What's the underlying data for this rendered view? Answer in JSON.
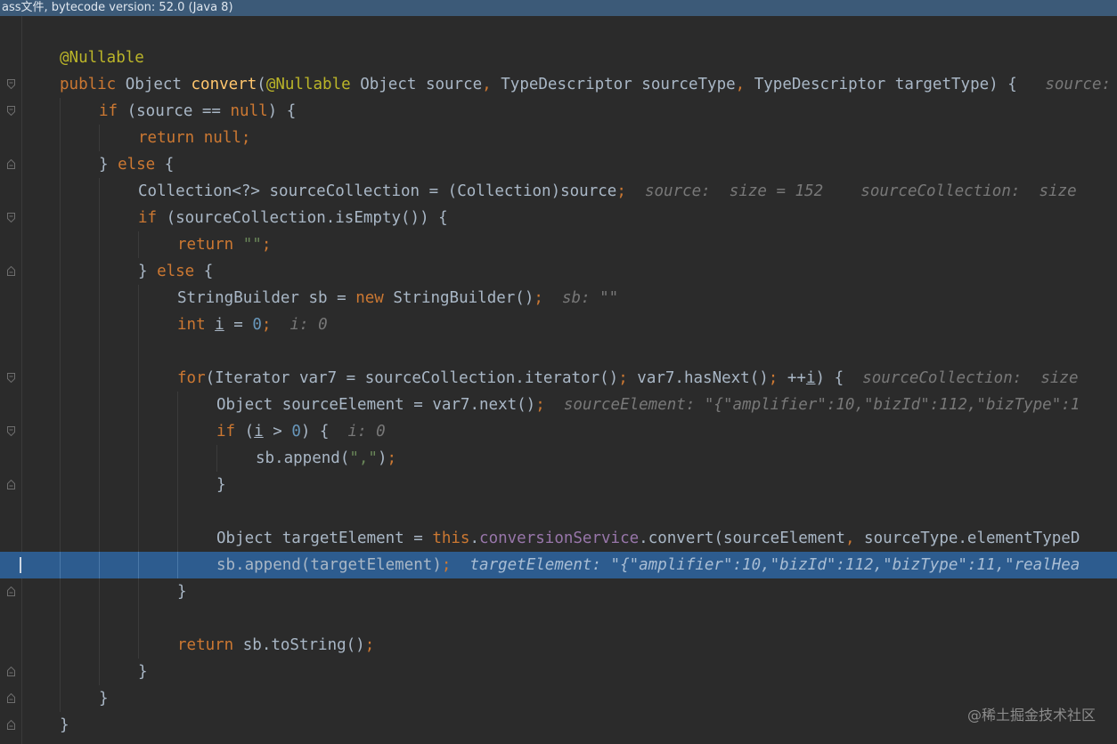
{
  "window": {
    "title_fragment": "ass文件, bytecode version: 52.0 (Java 8)"
  },
  "colors": {
    "background": "#2b2b2b",
    "keyword": "#cc7832",
    "annotation": "#bbb529",
    "method": "#ffc66d",
    "string": "#6a8759",
    "number": "#6897bb",
    "field": "#9876aa",
    "default_text": "#a9b7c6",
    "inline_hint": "#787878",
    "execution_line": "#2d5c8f"
  },
  "editor": {
    "current_line": "sb.append(targetElement);",
    "lines": [
      {
        "tokens": [
          {
            "t": "@Nullable"
          }
        ]
      },
      {
        "tokens": [
          {
            "t": "public"
          },
          {
            "t": " Object "
          },
          {
            "t": "convert"
          },
          {
            "t": "("
          },
          {
            "t": "@Nullable"
          },
          {
            "t": " Object source"
          },
          {
            "t": ","
          },
          {
            "t": " TypeDescriptor sourceType"
          },
          {
            "t": ","
          },
          {
            "t": " TypeDescriptor targetType) {"
          },
          {
            "t": "   source:"
          }
        ]
      },
      {
        "tokens": [
          {
            "t": "if"
          },
          {
            "t": " (source == "
          },
          {
            "t": "null"
          },
          {
            "t": ") {"
          }
        ]
      },
      {
        "tokens": [
          {
            "t": "return null"
          },
          {
            "t": ";"
          }
        ]
      },
      {
        "tokens": [
          {
            "t": "} "
          },
          {
            "t": "else"
          },
          {
            "t": " {"
          }
        ]
      },
      {
        "tokens": [
          {
            "t": "Collection<?> sourceCollection = (Collection)source"
          },
          {
            "t": ";"
          },
          {
            "t": "  source:  size = 152    sourceCollection:  size"
          }
        ]
      },
      {
        "tokens": [
          {
            "t": "if"
          },
          {
            "t": " (sourceCollection.isEmpty()) {"
          }
        ]
      },
      {
        "tokens": [
          {
            "t": "return "
          },
          {
            "t": "\"\""
          },
          {
            "t": ";"
          }
        ]
      },
      {
        "tokens": [
          {
            "t": "} "
          },
          {
            "t": "else"
          },
          {
            "t": " {"
          }
        ]
      },
      {
        "tokens": [
          {
            "t": "StringBuilder sb = "
          },
          {
            "t": "new"
          },
          {
            "t": " StringBuilder()"
          },
          {
            "t": ";"
          },
          {
            "t": "  sb: \"\""
          }
        ]
      },
      {
        "tokens": [
          {
            "t": "int "
          },
          {
            "t": "i"
          },
          {
            "t": " = "
          },
          {
            "t": "0"
          },
          {
            "t": ";"
          },
          {
            "t": "  i: 0"
          }
        ]
      },
      {
        "tokens": []
      },
      {
        "tokens": [
          {
            "t": "for"
          },
          {
            "t": "(Iterator var7 = sourceCollection.iterator()"
          },
          {
            "t": ";"
          },
          {
            "t": " var7.hasNext()"
          },
          {
            "t": ";"
          },
          {
            "t": " ++"
          },
          {
            "t": "i"
          },
          {
            "t": ") {"
          },
          {
            "t": "  sourceCollection:  size"
          }
        ]
      },
      {
        "tokens": [
          {
            "t": "Object sourceElement = var7.next()"
          },
          {
            "t": ";"
          },
          {
            "t": "  sourceElement: \"{\"amplifier\":10,\"bizId\":112,\"bizType\":1"
          }
        ]
      },
      {
        "tokens": [
          {
            "t": "if"
          },
          {
            "t": " ("
          },
          {
            "t": "i"
          },
          {
            "t": " > "
          },
          {
            "t": "0"
          },
          {
            "t": ") {"
          },
          {
            "t": "  i: 0"
          }
        ]
      },
      {
        "tokens": [
          {
            "t": "sb.append("
          },
          {
            "t": "\",\""
          },
          {
            "t": ")"
          },
          {
            "t": ";"
          }
        ]
      },
      {
        "tokens": [
          {
            "t": "}"
          }
        ]
      },
      {
        "tokens": []
      },
      {
        "tokens": [
          {
            "t": "Object targetElement = "
          },
          {
            "t": "this"
          },
          {
            "t": "."
          },
          {
            "t": "conversionService"
          },
          {
            "t": ".convert(sourceElement"
          },
          {
            "t": ","
          },
          {
            "t": " sourceType.elementTypeD"
          }
        ]
      },
      {
        "tokens": [
          {
            "t": "sb.append(targetElement)"
          },
          {
            "t": ";"
          },
          {
            "t": "  targetElement: \"{\"amplifier\":10,\"bizId\":112,\"bizType\":11,\"realHea"
          }
        ]
      },
      {
        "tokens": [
          {
            "t": "}"
          }
        ]
      },
      {
        "tokens": []
      },
      {
        "tokens": [
          {
            "t": "return"
          },
          {
            "t": " sb.toString()"
          },
          {
            "t": ";"
          }
        ]
      },
      {
        "tokens": [
          {
            "t": "}"
          }
        ]
      },
      {
        "tokens": [
          {
            "t": "}"
          }
        ]
      },
      {
        "tokens": [
          {
            "t": "}"
          }
        ]
      }
    ]
  },
  "gutter_icons": [
    "fold-marker-icon"
  ],
  "watermark": "@稀土掘金技术社区"
}
